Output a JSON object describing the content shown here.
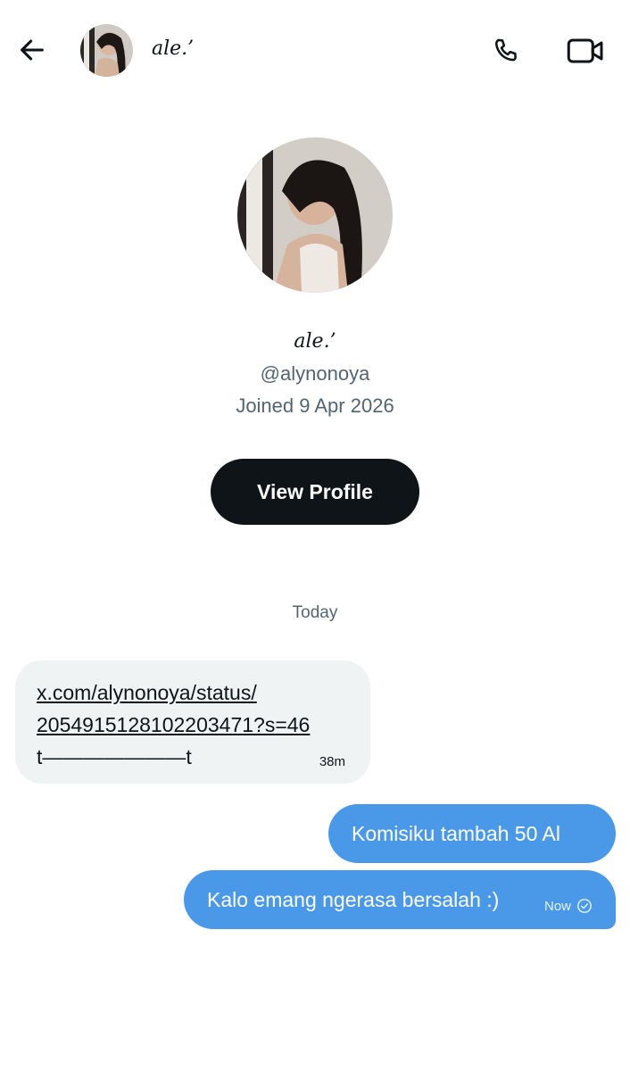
{
  "header": {
    "name": "ale.’",
    "back_icon": "arrow-left-icon",
    "call_icon": "phone-icon",
    "video_icon": "video-camera-icon"
  },
  "profile": {
    "name": "ale.’",
    "handle": "@alynonoya",
    "joined": "Joined 9 Apr 2026",
    "view_profile_label": "View Profile"
  },
  "conversation": {
    "day_label": "Today",
    "messages": [
      {
        "direction": "incoming",
        "link_line1": "x.com/alynonoya/status/",
        "link_line2": "2054915128102203471?s=46",
        "tail": "t———————t",
        "time": "38m"
      },
      {
        "direction": "outgoing",
        "text": "Komisiku tambah 50 Al"
      },
      {
        "direction": "outgoing",
        "text": "Kalo emang ngerasa bersalah :)",
        "time": "Now",
        "status_icon": "check-circle-icon"
      }
    ]
  },
  "colors": {
    "primary_text": "#0f1419",
    "secondary_text": "#536471",
    "outgoing_bubble": "#4a99e9",
    "incoming_bubble": "#eff3f4",
    "button_dark": "#0f1419"
  }
}
